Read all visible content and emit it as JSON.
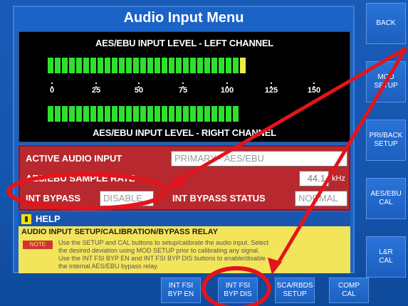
{
  "title": "Audio Input Menu",
  "meter": {
    "left_label": "AES/EBU INPUT LEVEL - LEFT CHANNEL",
    "right_label": "AES/EBU INPUT LEVEL - RIGHT CHANNEL",
    "ticks": [
      "0",
      "25",
      "50",
      "75",
      "100",
      "125",
      "150"
    ],
    "left_level_segments": 27,
    "right_level_segments": 27,
    "colors": {
      "bar": "#2fe02f",
      "peak": "#f2e74a"
    }
  },
  "settings": {
    "active_input_label": "ACTIVE AUDIO INPUT",
    "active_input_value": "PRIMARY - AES/EBU",
    "sample_rate_label": "AES/EBU SAMPLE RATE",
    "sample_rate_value": "44.1",
    "sample_rate_unit": "kHz",
    "int_bypass_label": "INT BYPASS",
    "int_bypass_value": "DISABLE",
    "int_bypass_status_label": "INT BYPASS STATUS",
    "int_bypass_status_value": "NORMAL"
  },
  "help": {
    "label": "HELP",
    "title": "AUDIO INPUT SETUP/CALIBRATION/BYPASS RELAY",
    "note": "NOTE",
    "line1": "Use the SETUP and CAL buttons to setup/calibrate the audio input. Select",
    "line2": "the desired deviation using MOD SETUP prior to calibrating any signal.",
    "line3": "Use the INT FSI BYP EN and INT FSI BYP DIS buttons to enable/disable",
    "line4": "the internal AES/EBU bypass relay."
  },
  "side_buttons": [
    {
      "line1": "BACK",
      "line2": ""
    },
    {
      "line1": "MOD",
      "line2": "SETUP"
    },
    {
      "line1": "PRI/BACK",
      "line2": "SETUP"
    },
    {
      "line1": "AES/EBU",
      "line2": "CAL"
    },
    {
      "line1": "L&R",
      "line2": "CAL"
    }
  ],
  "bottom_buttons": [
    {
      "line1": "INT FSI",
      "line2": "BYP EN"
    },
    {
      "line1": "INT FSI",
      "line2": "BYP DIS"
    },
    {
      "line1": "SCA/RBDS",
      "line2": "SETUP"
    },
    {
      "line1": "COMP",
      "line2": "CAL"
    }
  ],
  "annotation_color": "#e3141c"
}
